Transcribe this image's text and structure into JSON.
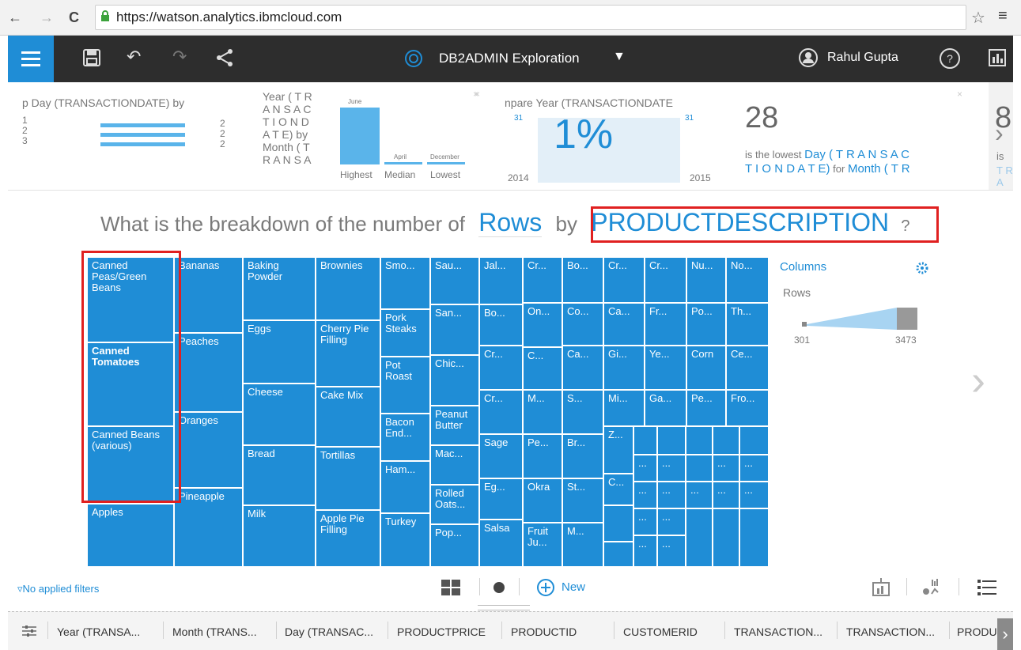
{
  "browser": {
    "url": "https://watson.analytics.ibmcloud.com"
  },
  "header": {
    "title": "DB2ADMIN Exploration",
    "user": "Rahul Gupta",
    "help": "?"
  },
  "insights": {
    "card1_title": "p Day (TRANSACTIONDATE) by",
    "card1_left": [
      "1",
      "2",
      "3"
    ],
    "card1_right": [
      "2",
      "2",
      "2"
    ],
    "card2_title_lines": [
      "Year ( T R",
      "A N S A C",
      "T I O N D",
      "A T E) by",
      "Month ( T",
      "R A N S A"
    ],
    "card2_bar_top": "June",
    "card2_bar_mid": "April",
    "card2_bar_low": "December",
    "card2_labels": [
      "Highest",
      "Median",
      "Lowest"
    ],
    "card3_title": "npare Year (TRANSACTIONDATE",
    "card3_percent": "1%",
    "card3_left_small": "31",
    "card3_right_small": "31",
    "card3_year_left": "2014",
    "card3_year_right": "2015",
    "card4_number": "28",
    "card4_text_prefix": "is the lowest ",
    "card4_text_blue1": "Day ( T R A N S A C",
    "card4_text_blue2": "T I O N D A T E)",
    "card4_text_mid": " for ",
    "card4_text_blue3": "Month ( T R",
    "card5_number": "8",
    "card5_text": "is",
    "card5_text2": "T R A"
  },
  "question": {
    "prefix": "What is the breakdown of the number of",
    "measure": "Rows",
    "by": "by",
    "dimension": "PRODUCTDESCRIPTION",
    "suffix": "?"
  },
  "treemap": {
    "tiles": [
      "Canned Peas/Green Beans",
      "Canned Tomatoes",
      "Canned Beans (various)",
      "Apples",
      "Bananas",
      "Peaches",
      "Oranges",
      "Pineapple",
      "Baking Powder",
      "Eggs",
      "Cheese",
      "Bread",
      "Milk",
      "Brownies",
      "Cherry Pie Filling",
      "Cake Mix",
      "Tortillas",
      "Apple Pie Filling",
      "Smo...",
      "Pork Steaks",
      "Pot Roast",
      "Bacon End...",
      "Ham...",
      "Turkey",
      "Sau...",
      "San...",
      "Chic...",
      "Peanut Butter",
      "Mac...",
      "Rolled Oats...",
      "Pop...",
      "Jal...",
      "Bo...",
      "Cr...",
      "Cr...",
      "Sage",
      "Eg...",
      "Salsa",
      "Cr...",
      "On...",
      "C...",
      "M...",
      "Pe...",
      "Okra",
      "Fruit Ju...",
      "Bo...",
      "Co...",
      "Ca...",
      "S...",
      "Br...",
      "St...",
      "M...",
      "Cr...",
      "Ca...",
      "Gi...",
      "Mi...",
      "Z...",
      "C...",
      "Cr...",
      "Fr...",
      "Ye...",
      "Ga...",
      "Nu...",
      "Po...",
      "Corn",
      "Pe...",
      "No...",
      "Th...",
      "Ce...",
      "Fro...",
      "..."
    ]
  },
  "legend": {
    "title": "Columns",
    "subtitle": "Rows",
    "min": "301",
    "max": "3473",
    "settings_icon": "gear-icon"
  },
  "footer": {
    "filters": "No applied filters",
    "new_label": "New"
  },
  "columns": {
    "items": [
      "Year (TRANSA...",
      "Month (TRANS...",
      "Day (TRANSAC...",
      "PRODUCTPRICE",
      "PRODUCTID",
      "CUSTOMERID",
      "TRANSACTION...",
      "TRANSACTION...",
      "PRODU"
    ]
  },
  "colors": {
    "accent": "#1f8dd6",
    "highlight": "#e02020",
    "header_bg": "#2d2d2d"
  }
}
